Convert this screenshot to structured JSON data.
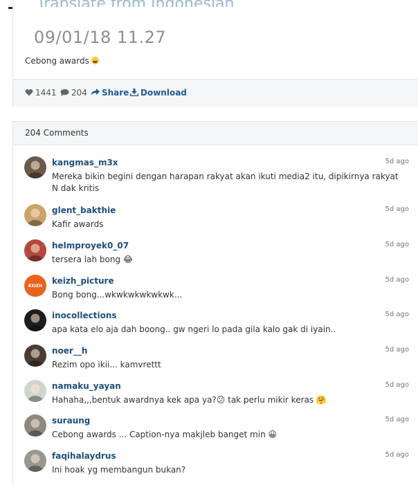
{
  "post": {
    "translate_link": "Translate from Indonesian",
    "date": "09/01/18 11.27",
    "caption": "Cebong awards",
    "caption_emoji": "face-with-tears-of-joy",
    "likes": "1441",
    "comments_count": "204",
    "share_label": "Share",
    "download_label": "Download"
  },
  "comments_section": {
    "header": "204 Comments",
    "items": [
      {
        "username": "kangmas_m3x",
        "text": "Mereka bikin begini dengan harapan rakyat akan ikuti media2 itu, dipikirnya rakyat N dak kritis",
        "time": "5d ago",
        "avatar_color": "#6b5a4a"
      },
      {
        "username": "glent_bakthie",
        "text": "Kafir awards",
        "time": "5d ago",
        "avatar_color": "#c9a36b"
      },
      {
        "username": "helmproyek0_07",
        "text": "tersera lah bong 😂",
        "time": "5d ago",
        "avatar_color": "#b5473d"
      },
      {
        "username": "keizh_picture",
        "text": "Bong bong...wkwkwkwkwkwk...",
        "time": "5d ago",
        "avatar_color": "#e8641e",
        "avatar_text": "KEIZH"
      },
      {
        "username": "inocollections",
        "text": "apa kata elo aja dah boong.. gw ngeri lo pada gila kalo gak di iyain..",
        "time": "5d ago",
        "avatar_color": "#1e1e1e"
      },
      {
        "username": "noer__h",
        "text": "Rezim opo ikii... kamvrettt",
        "time": "5d ago",
        "avatar_color": "#4a3b33"
      },
      {
        "username": "namaku_yayan",
        "text": "Hahaha,,,bentuk awardnya kek apa ya?😕 tak perlu mikir keras 🤗",
        "time": "5d ago",
        "avatar_color": "#cfd6cf"
      },
      {
        "username": "suraung",
        "text": "Cebong awards ... Caption-nya makjleb banget min 😀",
        "time": "5d ago",
        "avatar_color": "#8c8a80"
      },
      {
        "username": "faqihalaydrus",
        "text": "Ini hoak yg membangun bukan?",
        "time": "5d ago",
        "avatar_color": "#9a9690"
      }
    ]
  }
}
